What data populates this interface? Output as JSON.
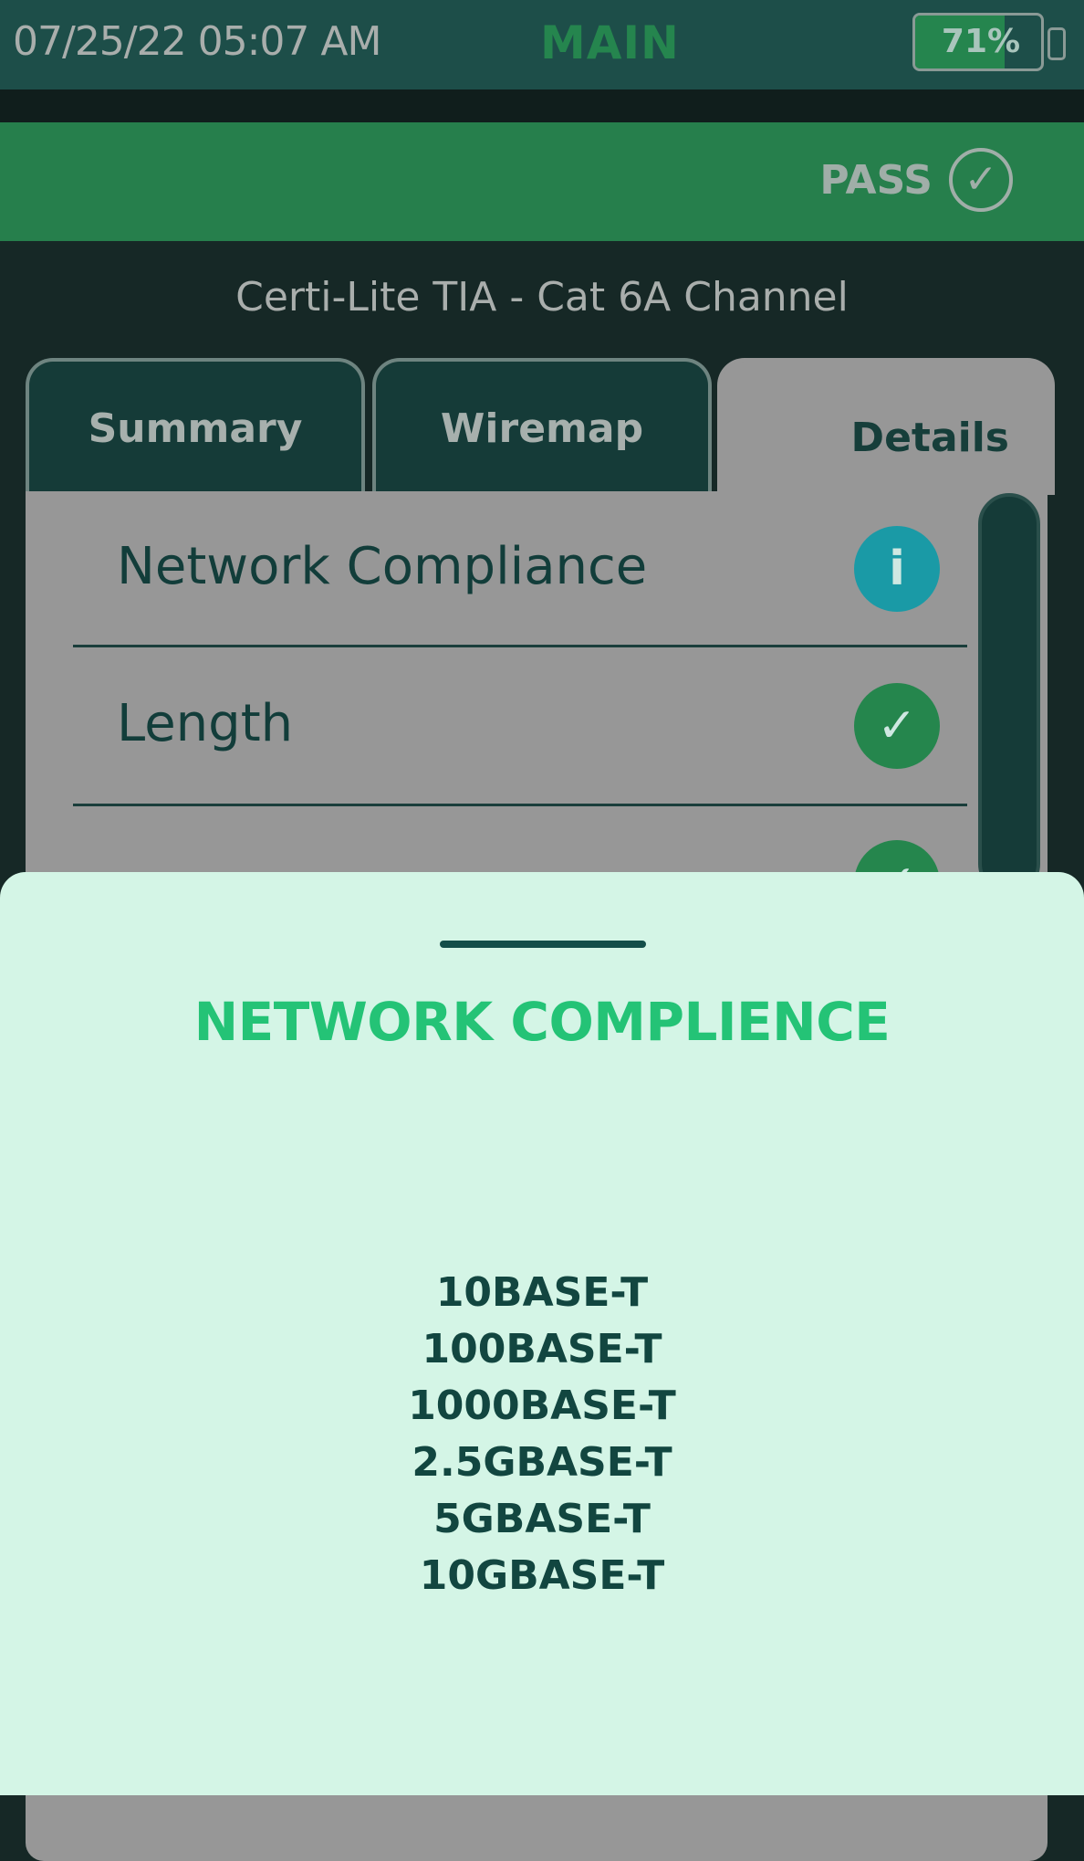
{
  "status_bar": {
    "datetime": "07/25/22 05:07 AM",
    "mode": "MAIN",
    "battery_text": "71%",
    "battery_level": 0.71
  },
  "result": {
    "label": "PASS",
    "icon": "check-circle-icon"
  },
  "test_name": "Certi-Lite TIA - Cat 6A Channel",
  "tabs": [
    {
      "label": "Summary"
    },
    {
      "label": "Wiremap"
    },
    {
      "label": "Details"
    }
  ],
  "details": {
    "rows": [
      {
        "label": "Network Compliance",
        "status_icon": "info-icon",
        "status_glyph": "i",
        "color": "#1a9aa6"
      },
      {
        "label": "Length",
        "status_icon": "check-icon",
        "status_glyph": "✓",
        "color": "#25864d"
      },
      {
        "label": "",
        "status_icon": "check-icon",
        "status_glyph": "✓",
        "color": "#25864d"
      }
    ]
  },
  "sheet": {
    "title": "NETWORK COMPLIENCE",
    "standards": [
      "10BASE-T",
      "100BASE-T",
      "1000BASE-T",
      "2.5GBASE-T",
      "5GBASE-T",
      "10GBASE-T"
    ]
  },
  "colors": {
    "accent_green": "#267f4c",
    "title_green": "#24c376",
    "dark_teal": "#153b38",
    "sheet_bg": "#d4f5e6",
    "info_teal": "#1a9aa6"
  }
}
